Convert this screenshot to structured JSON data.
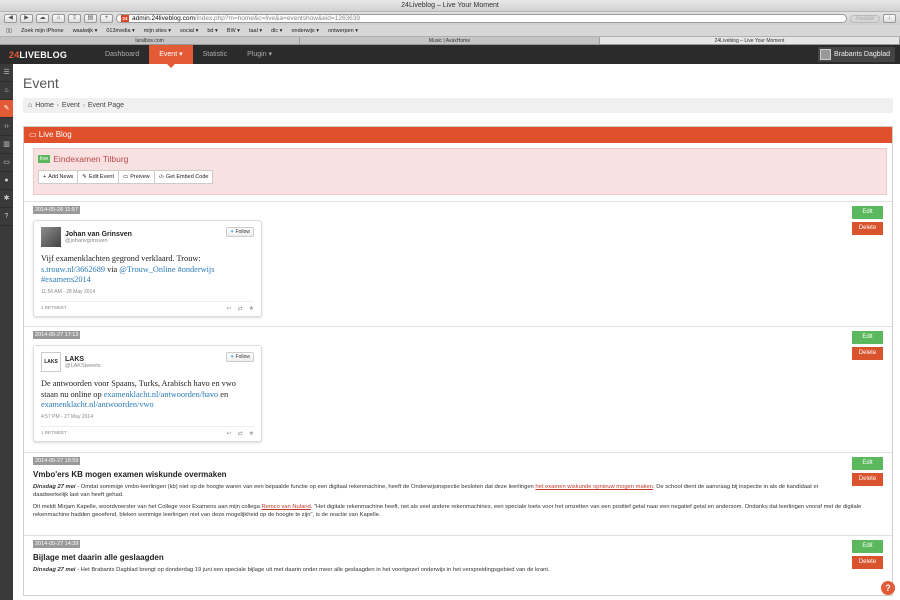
{
  "window": {
    "title": "24Liveblog – Live Your Moment"
  },
  "browser": {
    "url_host": "admin.24liveblog.com",
    "url_path": "/index.php?m=home&c=live&a=eventshow&eid=1263639",
    "reader_label": "Reader",
    "bookmarks": [
      "Zoek mijn iPhone",
      "waalwijk ▾",
      "013media ▾",
      "mijn sites ▾",
      "social ▾",
      "bd ▾",
      "BW ▾",
      "taal ▾",
      "dlc ▾",
      "onderwijs ▾",
      "ontwerpen ▾"
    ],
    "tabs": [
      "Iuralbos.com",
      "Music | AvaxHome",
      "24Liveblog – Live Your Moment"
    ]
  },
  "app": {
    "logo_num": "24",
    "logo_text": "LIVEBLOG",
    "nav": [
      "Dashboard",
      "Event ▾",
      "Statistic",
      "Plugin ▾"
    ],
    "user": "Brabants Dagblad"
  },
  "page": {
    "title": "Event",
    "breadcrumb": [
      "Home",
      "Event",
      "Event Page"
    ],
    "panel_title": "Live Blog",
    "live_badge": "live",
    "event_name": "Eindexamen Tilburg",
    "actions": [
      "Add News",
      "Edit Event",
      "Preivew",
      "Get Embed Code"
    ],
    "edit_label": "Edit",
    "delete_label": "Delete",
    "help_label": "?"
  },
  "posts": [
    {
      "ts": "2014-05-28 11:57",
      "tweet": {
        "name": "Johan van Grinsven",
        "handle": "@johanvgrinsven",
        "follow": "Follow",
        "text_a": "Vijf examenklachten gegrond verklaard. Trouw: ",
        "link1": "s.trouw.nl/3662689",
        "text_b": " via ",
        "link2": "@Trouw_Online",
        "text_c": " ",
        "link3": "#onderwijs",
        "text_d": " ",
        "link4": "#examens2014",
        "date": "11:56 AM - 28 May 2014",
        "retweet": "1 RETWEET"
      }
    },
    {
      "ts": "2014-05-27 17:13",
      "tweet": {
        "name": "LAKS",
        "handle": "@LAKStweets",
        "follow": "Follow",
        "avatar_text": "LAKS",
        "text_a": "De antwoorden voor Spaans, Turks, Arabisch havo en vwo staan nu online op ",
        "link1": "examenklacht.nl/antwoorden/havo",
        "text_b": " en ",
        "link2": "examenklacht.nl/antwoorden/vwo",
        "date": "4:57 PM - 27 May 2014",
        "retweet": "1 RETWEET"
      }
    },
    {
      "ts": "2014-05-27 15:59",
      "title": "Vmbo'ers KB mogen examen wiskunde overmaken",
      "p1_bold": "Dinsdag 27 mei",
      "p1_a": " - Omdat sommige vmbo-leerlingen (kb) niet op de hoogte waren van een bepaalde functie op een digitaal rekenmachine, heeft de Onderwijsinspectie besloten dat deze leerlingen ",
      "p1_link": "het examen wiskunde opnieuw mogen maken",
      "p1_b": ". De school dient de aanvraag bij inspectie in als de kandidaat er daadwerkelijk last van heeft gehad.",
      "p2_a": "Dit meldt Mirjam Kapelle, woordvoerster van het College voor Examens aan mijn collega ",
      "p2_link": "Remco van Nuland",
      "p2_b": ". \"Het digitale rekenmachine heeft, net als veel andere rekenmachines, een speciale toets voor het omzetten van een positief getal naar een negatief getal en andersom. Ondanks dat leerlingen vooraf met de digitale rekenmachine hadden geoefend, bleken sommige leerlingen niet van deze mogelijkheid op de hoogte te zijn\", is de reactie van Kapelle."
    },
    {
      "ts": "2014-05-27 14:39",
      "title": "Bijlage met daarin alle geslaagden",
      "p1_bold": "Dinsdag 27 mei",
      "p1_a": " - Het Brabants Dagblad brengt op donderdag 19 juni een speciale bijlage uit met daarin onder meer alle geslaagden in het voortgezet onderwijs in het verspreidingsgebied van de krant."
    }
  ]
}
